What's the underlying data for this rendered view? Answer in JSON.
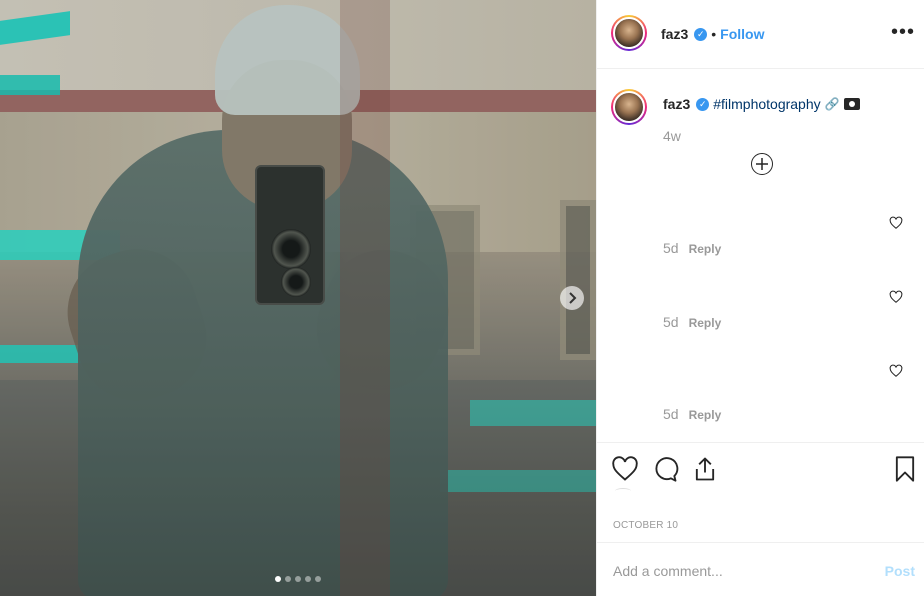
{
  "post": {
    "username": "faz3",
    "follow_label": "Follow",
    "separator": "•",
    "more_label": "•••",
    "caption_username": "faz3",
    "caption_hashtag": "#filmphotography",
    "caption_link_emoji": "🔗",
    "time_posted": "4w",
    "date": "OCTOBER 10",
    "carousel": {
      "count": 5,
      "active": 1
    }
  },
  "comments": [
    {
      "ago": "5d",
      "reply_label": "Reply"
    },
    {
      "ago": "5d",
      "reply_label": "Reply"
    },
    {
      "ago": "5d",
      "reply_label": "Reply"
    }
  ],
  "add_comment": {
    "placeholder": "Add a comment...",
    "post_label": "Post"
  },
  "icons": {
    "more": "more-options-icon",
    "verified": "verified-badge-icon",
    "load_more": "plus-circle-icon",
    "heart": "heart-icon",
    "comment": "comment-icon",
    "share": "share-icon",
    "save": "bookmark-icon",
    "next": "chevron-right-icon",
    "camera": "camera-emoji-icon"
  },
  "colors": {
    "link": "#3897f0",
    "hashtag": "#003569",
    "muted": "#999999",
    "post_disabled": "#b2dffc",
    "border": "#efefef"
  }
}
